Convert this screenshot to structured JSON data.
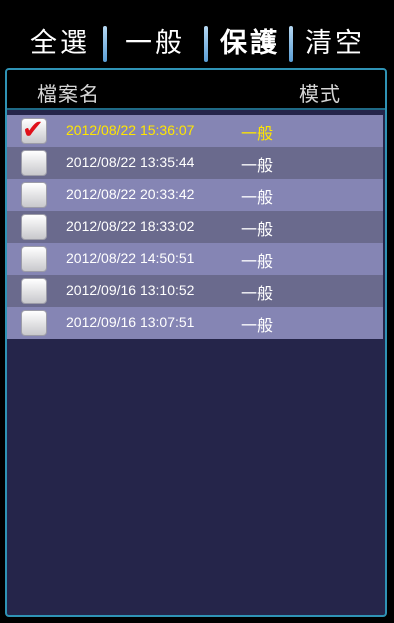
{
  "toolbar": {
    "select_all": "全選",
    "general": "一般",
    "protect": "保護",
    "clear": "清空"
  },
  "table": {
    "col_name": "檔案名",
    "col_mode": "模式"
  },
  "files": [
    {
      "timestamp": "2012/08/22 15:36:07",
      "mode": "一般",
      "checked": true
    },
    {
      "timestamp": "2012/08/22 13:35:44",
      "mode": "一般",
      "checked": false
    },
    {
      "timestamp": "2012/08/22 20:33:42",
      "mode": "一般",
      "checked": false
    },
    {
      "timestamp": "2012/08/22 18:33:02",
      "mode": "一般",
      "checked": false
    },
    {
      "timestamp": "2012/08/22 14:50:51",
      "mode": "一般",
      "checked": false
    },
    {
      "timestamp": "2012/09/16 13:10:52",
      "mode": "一般",
      "checked": false
    },
    {
      "timestamp": "2012/09/16 13:07:51",
      "mode": "一般",
      "checked": false
    }
  ],
  "colors": {
    "selected_text": "#ffe600",
    "checkmark": "#e0101a",
    "panel_border": "#2f93b5",
    "row_light": "#8585b4",
    "row_dark": "#6a6a8d"
  },
  "icons": {
    "checkmark": "checkmark-icon"
  }
}
